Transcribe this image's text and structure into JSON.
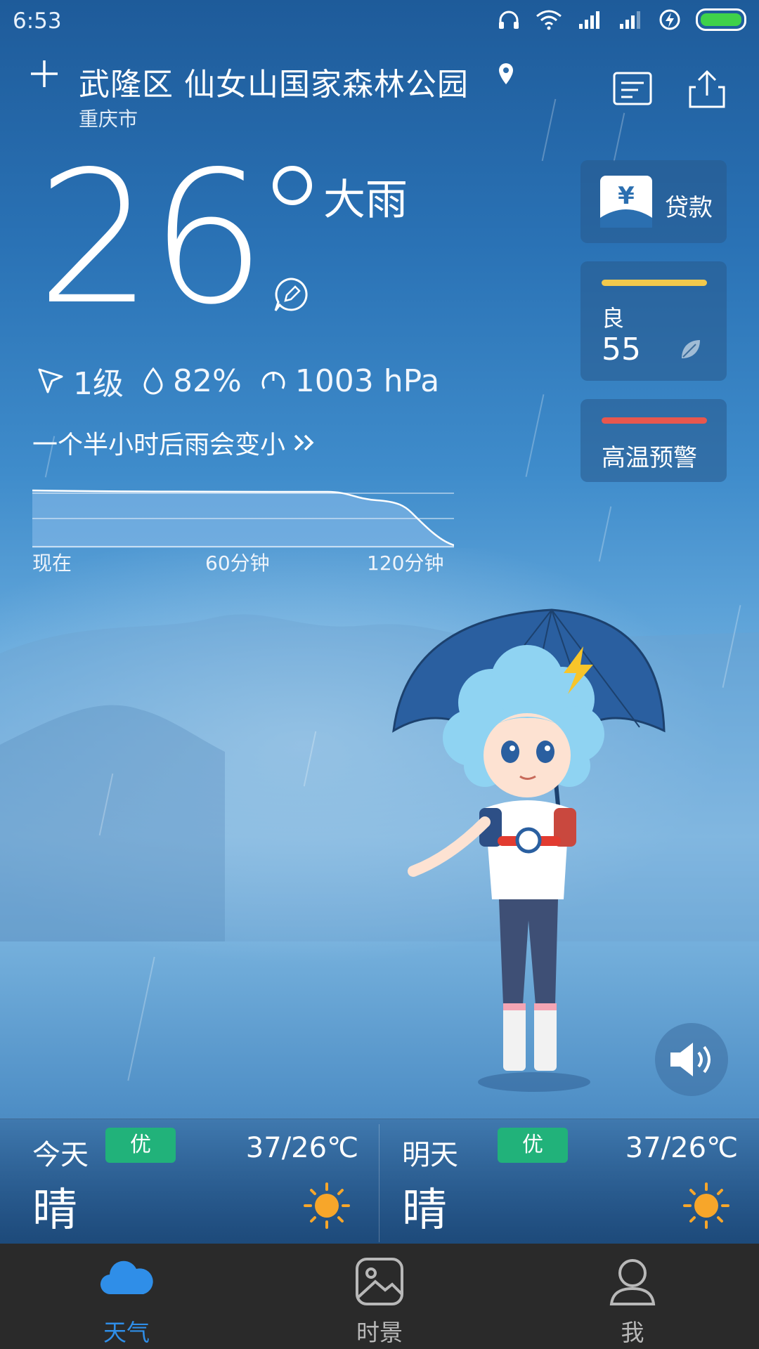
{
  "status_bar": {
    "time": "6:53"
  },
  "location": {
    "title": "武隆区 仙女山国家森林公园",
    "city": "重庆市"
  },
  "current": {
    "temperature": "26",
    "condition": "大雨",
    "wind": "1级",
    "humidity": "82%",
    "pressure": "1003 hPa"
  },
  "nowcast": {
    "text": "一个半小时后雨会变小",
    "axis": [
      "现在",
      "60分钟",
      "120分钟"
    ]
  },
  "cards": {
    "loan": {
      "label": "贷款",
      "icon_text": "¥"
    },
    "aqi": {
      "level": "良",
      "value": "55",
      "bar_color": "#f2c94c"
    },
    "warning": {
      "label": "高温预警",
      "bar_color": "#e8574e"
    }
  },
  "forecast": [
    {
      "name": "今天",
      "quality": "优",
      "range": "37/26℃",
      "condition": "晴"
    },
    {
      "name": "明天",
      "quality": "优",
      "range": "37/26℃",
      "condition": "晴"
    }
  ],
  "tabs": [
    {
      "label": "天气",
      "icon": "cloud-icon",
      "active": true
    },
    {
      "label": "时景",
      "icon": "picture-icon",
      "active": false
    },
    {
      "label": "我",
      "icon": "person-icon",
      "active": false
    }
  ],
  "colors": {
    "accent": "#2f8ee8",
    "badge_green": "#21b27a"
  }
}
